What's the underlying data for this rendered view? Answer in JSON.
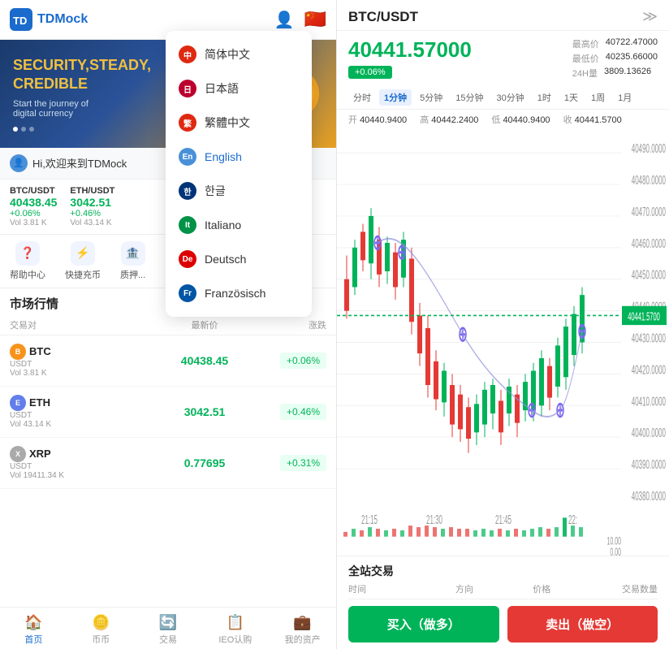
{
  "app": {
    "name": "TDMock",
    "logo_text": "TDMock"
  },
  "header": {
    "user_icon": "👤",
    "flag_icon": "🇨🇳"
  },
  "banner": {
    "title": "SECURITY,STEADY,\nCREDIBLE",
    "subtitle": "Start the journey of\ndigital currency"
  },
  "welcome": {
    "text": "Hi,欢迎来到TDMock"
  },
  "tickers": [
    {
      "pair": "BTC/USDT",
      "price": "40438.45",
      "change": "+0.06%",
      "vol": "Vol 3.81 K"
    },
    {
      "pair": "ETH/USDT",
      "price": "3042.51",
      "change": "+0.46%",
      "vol": "Vol 43.14 K"
    }
  ],
  "quick_nav": [
    {
      "icon": "❓",
      "label": "帮助中心"
    },
    {
      "icon": "⚡",
      "label": "快捷充币"
    },
    {
      "icon": "🏠",
      "label": "质押..."
    }
  ],
  "market": {
    "title": "市场行情",
    "headers": [
      "交易对",
      "最新价",
      "涨跌"
    ],
    "rows": [
      {
        "coin": "BTC",
        "base": "USDT",
        "vol": "Vol 3.81 K",
        "price": "40438.45",
        "price_sub": "",
        "change": "+0.06%",
        "up": true,
        "color": "btc"
      },
      {
        "coin": "ETH",
        "base": "USDT",
        "vol": "Vol 43.14 K",
        "price": "3042.51",
        "price_sub": "",
        "change": "+0.46%",
        "up": true,
        "color": "eth"
      },
      {
        "coin": "XRP",
        "base": "USDT",
        "vol": "Vol 19411.34 K",
        "price": "0.77695",
        "price_sub": "",
        "change": "+0.31%",
        "up": true,
        "color": "xrp"
      }
    ]
  },
  "bottom_nav": [
    {
      "icon": "🏠",
      "label": "首页",
      "active": true
    },
    {
      "icon": "🪙",
      "label": "币币",
      "active": false
    },
    {
      "icon": "🔄",
      "label": "交易",
      "active": false
    },
    {
      "icon": "📋",
      "label": "IEO认购",
      "active": false
    },
    {
      "icon": "💼",
      "label": "我的资产",
      "active": false
    }
  ],
  "chart": {
    "pair": "BTC/USDT",
    "price": "40441.57000",
    "change": "+0.06%",
    "high_label": "最高价",
    "low_label": "最低价",
    "vol_label": "24H量",
    "high": "40722.47000",
    "low": "40235.66000",
    "vol": "3809.13626",
    "current_price_label": "40441.5700",
    "ohlc": {
      "open_label": "开",
      "open": "40440.9400",
      "high_label": "高",
      "high": "40442.2400",
      "low_label": "低",
      "low": "40440.9400",
      "close_label": "收",
      "close": "40441.5700"
    },
    "time_tabs": [
      "分时",
      "1分钟",
      "5分钟",
      "15分钟",
      "30分钟",
      "1时",
      "1天",
      "1周",
      "1月"
    ],
    "active_tab": "1分钟",
    "time_labels": [
      "21:15",
      "21:30",
      "21:45",
      "22:"
    ],
    "y_labels": [
      "40490.0000",
      "40480.0000",
      "40470.0000",
      "40460.0000",
      "40450.0000",
      "40440.0000",
      "40430.0000",
      "40420.0000",
      "40410.0000",
      "40400.0000",
      "40390.0000",
      "40380.0000"
    ]
  },
  "trade_history": {
    "title": "全站交易",
    "headers": [
      "时间",
      "方向",
      "价格",
      "交易数量"
    ]
  },
  "action_buttons": {
    "buy": "买入（做多）",
    "sell": "卖出（做空）"
  },
  "language_dropdown": {
    "items": [
      {
        "flag": "🇨🇳",
        "label": "简体中文",
        "selected": false
      },
      {
        "flag": "🇯🇵",
        "label": "日本語",
        "selected": false
      },
      {
        "flag": "🇨🇳",
        "label": "繁體中文",
        "selected": false
      },
      {
        "flag": "🌐",
        "label": "English",
        "selected": true
      },
      {
        "flag": "🇰🇷",
        "label": "한글",
        "selected": false
      },
      {
        "flag": "🇮🇹",
        "label": "Italiano",
        "selected": false
      },
      {
        "flag": "🇩🇪",
        "label": "Deutsch",
        "selected": false
      },
      {
        "flag": "🇫🇷",
        "label": "Französisch",
        "selected": false
      }
    ]
  }
}
